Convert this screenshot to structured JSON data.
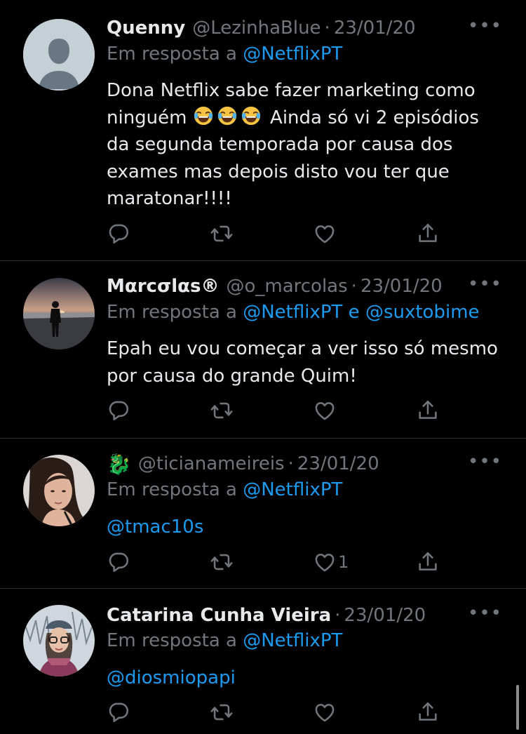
{
  "tweets": [
    {
      "name": "Quenny",
      "handle": "@LezinhaBlue",
      "dot": "·",
      "date": "23/01/20",
      "more": "•••",
      "reply_prefix": "Em resposta a ",
      "reply_to": "@NetflixPT",
      "text_a": "Dona Netflix sabe fazer marketing como ninguém ",
      "text_b": " Ainda só vi 2 episódios da segunda temporada por causa dos exames mas depois disto vou ter que maratonar!!!!"
    },
    {
      "name": "Mαrcσlαs®",
      "handle": "@o_marcolas",
      "dot": "·",
      "date": "23/01/20",
      "more": "•••",
      "reply_prefix": "Em resposta a ",
      "reply_to": "@NetflixPT",
      "reply_and": " e ",
      "reply_to_2": "@suxtobime",
      "text": "Epah eu vou começar a ver isso só mesmo por causa do grande Quim!"
    },
    {
      "name_emoji": "🐉",
      "handle": "@ticianameireis",
      "dot": "·",
      "date": "23/01/20",
      "more": "•••",
      "reply_prefix": "Em resposta a ",
      "reply_to": "@NetflixPT",
      "text_mention": "@tmac10s",
      "like_count": "1"
    },
    {
      "name": "Catarina Cunha Vieira",
      "dot": "·",
      "date": "23/01/20",
      "more": "•••",
      "reply_prefix": "Em resposta a ",
      "reply_to": "@NetflixPT",
      "text_mention": "@diosmiopapi"
    }
  ],
  "icons": [
    "reply-icon",
    "retweet-icon",
    "like-icon",
    "share-icon",
    "more-icon",
    "laughing-emoji"
  ],
  "colors": {
    "background": "#000000",
    "text": "#e7e9ea",
    "muted": "#71767b",
    "link": "#1d9bf0",
    "divider": "#2f3336"
  }
}
